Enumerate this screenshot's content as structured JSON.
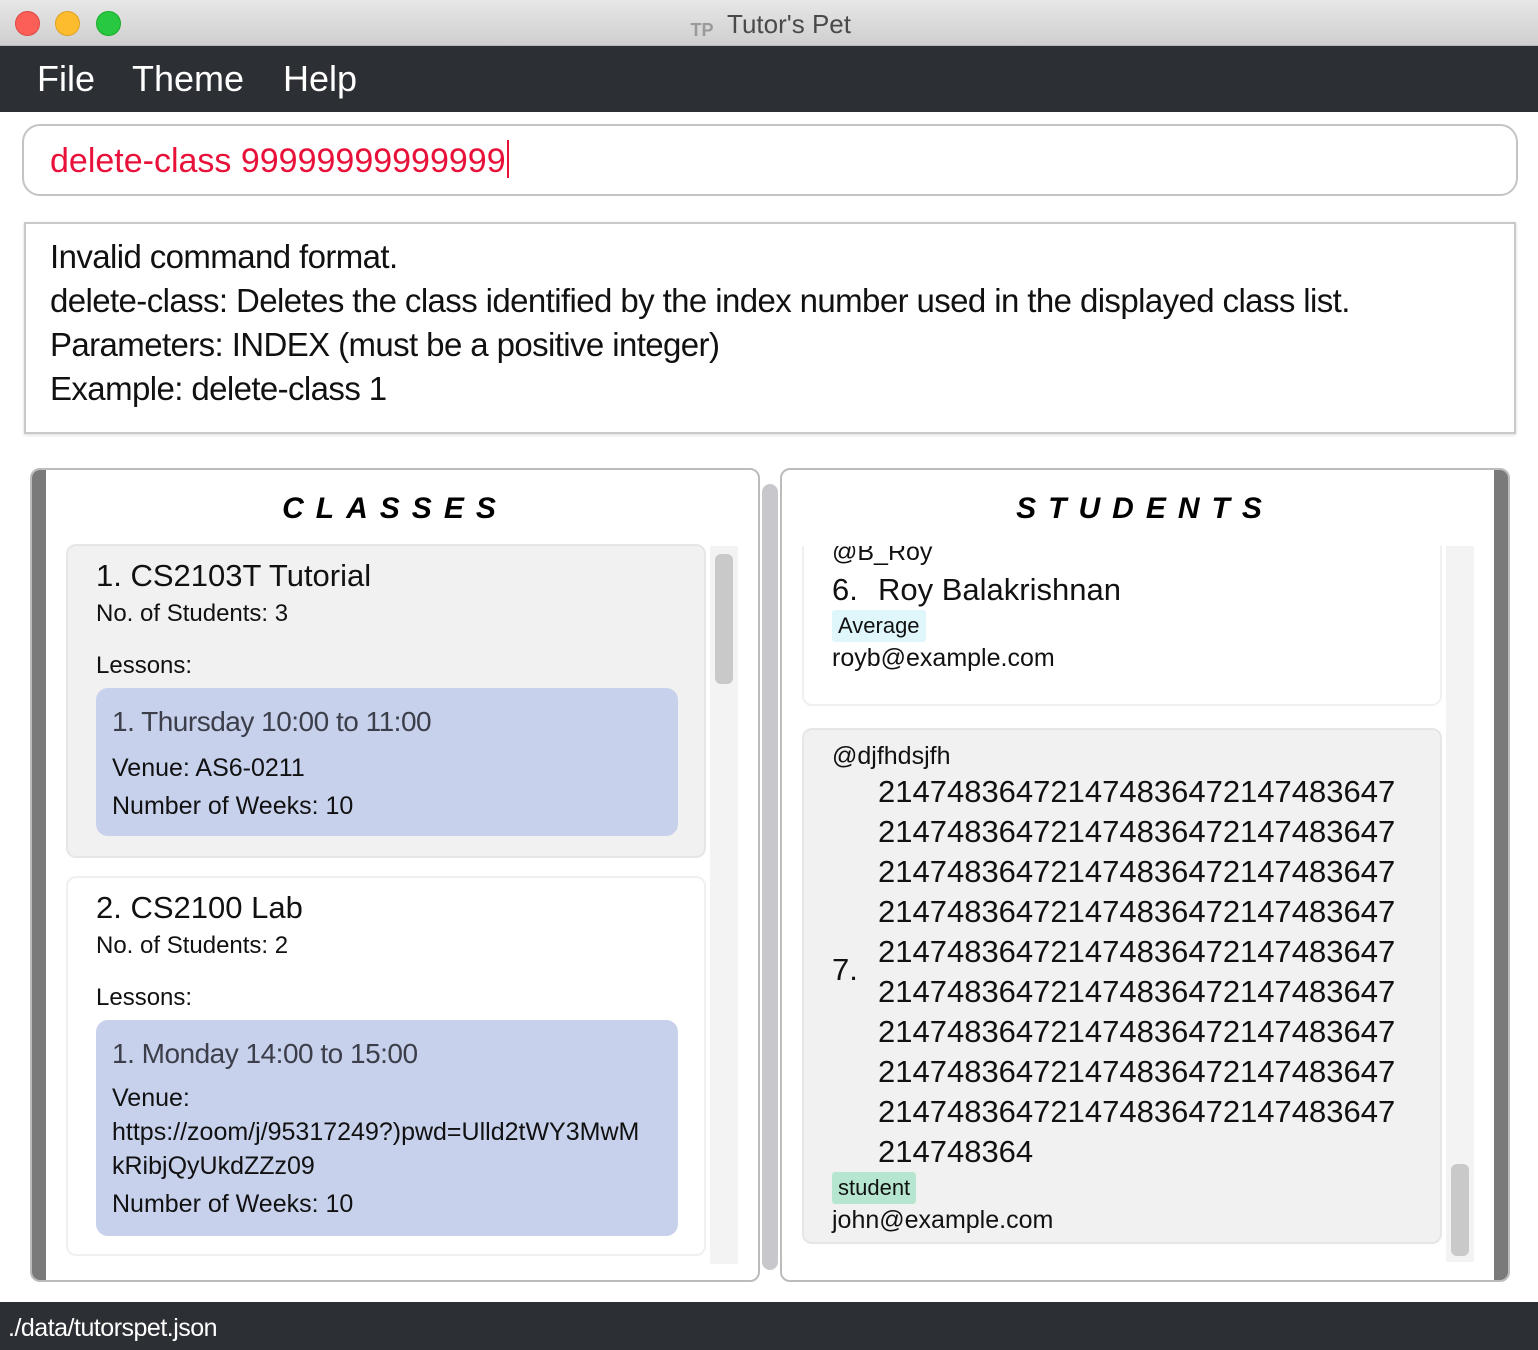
{
  "window": {
    "title": "Tutor's Pet",
    "icon": "tutors-pet-app-icon",
    "icon_text": "TP"
  },
  "menu": {
    "items": [
      "File",
      "Theme",
      "Help"
    ]
  },
  "command_box": {
    "value": "delete-class 99999999999999",
    "color": "#e8113a"
  },
  "result": {
    "lines": [
      "Invalid command format.",
      "delete-class: Deletes the class identified by the index number used in the displayed class list.",
      "Parameters: INDEX (must be a positive integer)",
      "Example: delete-class 1"
    ]
  },
  "classes_panel": {
    "heading": "CLASSES",
    "items": [
      {
        "title": "1.  CS2103T Tutorial",
        "students": "No. of Students:  3",
        "lessons_label": "Lessons:",
        "lesson": {
          "time": "1. Thursday 10:00 to 11:00",
          "venue": "Venue: AS6-0211",
          "weeks": "Number of Weeks: 10"
        }
      },
      {
        "title": "2.  CS2100 Lab",
        "students": "No. of Students:  2",
        "lessons_label": "Lessons:",
        "lesson": {
          "time": "1. Monday 14:00 to 15:00",
          "venue_label": "Venue:",
          "venue_lines": [
            "https://zoom/j/95317249?)pwd=Ulld2tWY3MwM",
            "kRibjQyUkdZZz09"
          ],
          "weeks": "Number of Weeks: 10"
        }
      }
    ]
  },
  "students_panel": {
    "heading": "STUDENTS",
    "items": [
      {
        "telegram": "@B_Roy",
        "index": "6.",
        "name": "Roy Balakrishnan",
        "tag": "Average",
        "email": "royb@example.com"
      },
      {
        "telegram": "@djfhdsjfh",
        "index": "7.",
        "name_lines": [
          "214748364721474836472147483647",
          "214748364721474836472147483647",
          "214748364721474836472147483647",
          "214748364721474836472147483647",
          "214748364721474836472147483647",
          "214748364721474836472147483647",
          "214748364721474836472147483647",
          "214748364721474836472147483647",
          "214748364721474836472147483647",
          "214748364"
        ],
        "tag": "student",
        "email": "john@example.com"
      }
    ]
  },
  "status_bar": {
    "path": "./data/tutorspet.json"
  }
}
